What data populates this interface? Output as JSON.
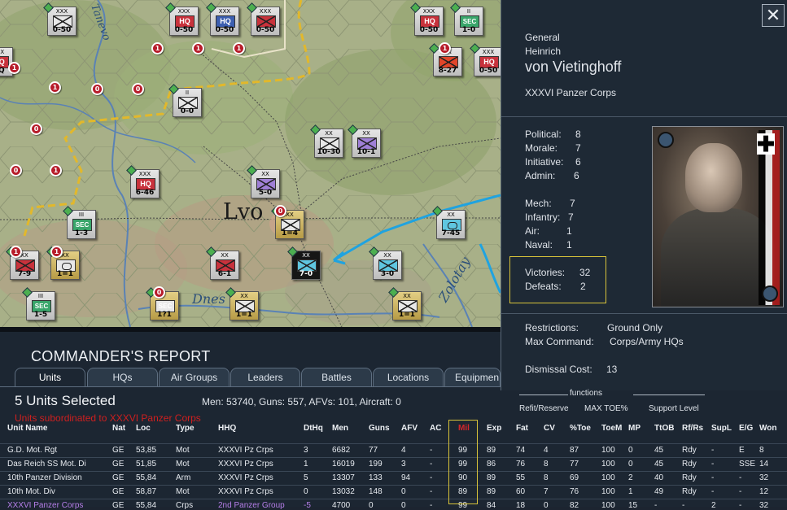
{
  "map": {
    "city": "Lvo",
    "river_labels": [
      "Dnes",
      "Zolotay",
      "Tanevo"
    ],
    "counters": [
      {
        "size": "XXX",
        "val": "0-50",
        "sym": "inf",
        "color": "#e8e8e8"
      },
      {
        "size": "XXX",
        "val": "0-50",
        "sym": "hq",
        "color": "#c8323c",
        "text": "HQ"
      },
      {
        "size": "XXX",
        "val": "0-50",
        "sym": "hq",
        "color": "#3d5fb0",
        "text": "HQ"
      },
      {
        "size": "XXX",
        "val": "0-50",
        "sym": "inf",
        "color": "#c8323c"
      },
      {
        "size": "XXX",
        "val": "0-50",
        "sym": "hq",
        "color": "#c8323c",
        "text": "HQ"
      },
      {
        "size": "II",
        "val": "1-0",
        "sym": "sec",
        "color": "#3aa66b",
        "text": "SEC"
      },
      {
        "size": "XX",
        "val": "8-27",
        "sym": "inf",
        "color": "#e0452a"
      },
      {
        "size": "XXX",
        "val": "0-50",
        "sym": "hq",
        "color": "#c8323c",
        "text": "HQ"
      },
      {
        "size": "XXX",
        "val": "HQ",
        "sym": "hq",
        "color": "#c8323c",
        "text": "HQ"
      },
      {
        "size": "II",
        "val": "0-0",
        "sym": "inf",
        "color": "#e8e8e8"
      },
      {
        "size": "XX",
        "val": "10-30",
        "sym": "inf",
        "color": "#e8e8e8"
      },
      {
        "size": "XX",
        "val": "10-1",
        "sym": "inf",
        "color": "#9f7fd6"
      },
      {
        "size": "XXX",
        "val": "6-46",
        "sym": "hq",
        "color": "#c8323c",
        "text": "HQ"
      },
      {
        "size": "XX",
        "val": "5-0",
        "sym": "inf",
        "color": "#9f7fd6"
      },
      {
        "size": "III",
        "val": "1-3",
        "sym": "sec",
        "color": "#3aa66b",
        "text": "SEC"
      },
      {
        "size": "XX",
        "val": "1=4",
        "sym": "inf",
        "color": "#e8e8e8"
      },
      {
        "size": "XX",
        "val": "7-45",
        "sym": "mot",
        "color": "#5fc6e0"
      },
      {
        "size": "XX",
        "val": "6-1",
        "sym": "inf",
        "color": "#c8323c"
      },
      {
        "size": "XX",
        "val": "7-0",
        "sym": "inf",
        "color": "#5fc6e0"
      },
      {
        "size": "XX",
        "val": "3-0",
        "sym": "inf",
        "color": "#5fc6e0"
      },
      {
        "size": "XX",
        "val": "7-9",
        "sym": "inf",
        "color": "#c8323c"
      },
      {
        "size": "XX",
        "val": "1=1",
        "sym": "mot",
        "color": "#e8e8e8"
      },
      {
        "size": "III",
        "val": "1-5",
        "sym": "sec",
        "color": "#3aa66b",
        "text": "SEC"
      },
      {
        "size": "",
        "val": "1?1",
        "sym": "sec",
        "color": "#e8e8e8",
        "text": "SEC"
      },
      {
        "size": "XX",
        "val": "1=1",
        "sym": "inf",
        "color": "#e8e8e8"
      },
      {
        "size": "XX",
        "val": "1=1",
        "sym": "inf",
        "color": "#e8e8e8"
      }
    ],
    "badges": [
      "1",
      "1",
      "1",
      "1",
      "0",
      "1",
      "0",
      "0",
      "1",
      "0",
      "1",
      "1",
      "1",
      "0",
      "0"
    ]
  },
  "commander": {
    "rank": "General",
    "first_name": "Heinrich",
    "last_name": "von Vietinghoff",
    "unit": "XXXVI Panzer Corps",
    "close_label": "✕",
    "ratings": [
      {
        "label": "Political:",
        "value": "8"
      },
      {
        "label": "Morale:",
        "value": "7"
      },
      {
        "label": "Initiative:",
        "value": "6"
      },
      {
        "label": "Admin:",
        "value": "6"
      },
      {
        "label": "Mech:",
        "value": "7"
      },
      {
        "label": "Infantry:",
        "value": "7"
      },
      {
        "label": "Air:",
        "value": "1"
      },
      {
        "label": "Naval:",
        "value": "1"
      }
    ],
    "victories_label": "Victories:",
    "victories": "32",
    "defeats_label": "Defeats:",
    "defeats": "2",
    "restrictions_label": "Restrictions:",
    "restrictions": "Ground Only",
    "max_command_label": "Max Command:",
    "max_command": "Corps/Army HQs",
    "dismissal_label": "Dismissal Cost:",
    "dismissal": "13"
  },
  "report": {
    "title": "COMMANDER'S REPORT",
    "tabs": [
      "Units",
      "HQs",
      "Air Groups",
      "Leaders",
      "Battles",
      "Locations",
      "Equipmen"
    ],
    "selected": "5 Units Selected",
    "summary": "Men: 53740, Guns: 557, AFVs: 101, Aircraft: 0",
    "warning": "Units subordinated to XXXVI Panzer Corps",
    "functions_label": "functions",
    "functions": [
      "Refit/Reserve",
      "MAX TOE%",
      "Support Level"
    ],
    "columns": [
      "Unit Name",
      "Nat",
      "Loc",
      "Type",
      "HHQ",
      "DtHq",
      "Men",
      "Guns",
      "AFV",
      "AC",
      "Mil",
      "Exp",
      "Fat",
      "CV",
      "%Toe",
      "ToeM",
      "MP",
      "TtOB",
      "Rf/Rs",
      "SupL",
      "E/G",
      "Won"
    ],
    "rows": [
      [
        "G.D. Mot. Rgt",
        "GE",
        "53,85",
        "Mot",
        "XXXVI Pz Crps",
        "3",
        "6682",
        "77",
        "4",
        "-",
        "99",
        "89",
        "74",
        "4",
        "87",
        "100",
        "0",
        "45",
        "Rdy",
        "-",
        "E",
        "8"
      ],
      [
        "Das Reich SS Mot. Di",
        "GE",
        "51,85",
        "Mot",
        "XXXVI Pz Crps",
        "1",
        "16019",
        "199",
        "3",
        "-",
        "99",
        "86",
        "76",
        "8",
        "77",
        "100",
        "0",
        "45",
        "Rdy",
        "-",
        "SSE",
        "14"
      ],
      [
        "10th Panzer Division",
        "GE",
        "55,84",
        "Arm",
        "XXXVI Pz Crps",
        "5",
        "13307",
        "133",
        "94",
        "-",
        "90",
        "89",
        "55",
        "8",
        "69",
        "100",
        "2",
        "40",
        "Rdy",
        "-",
        "-",
        "32"
      ],
      [
        "10th Mot. Div",
        "GE",
        "58,87",
        "Mot",
        "XXXVI Pz Crps",
        "0",
        "13032",
        "148",
        "0",
        "-",
        "89",
        "89",
        "60",
        "7",
        "76",
        "100",
        "1",
        "49",
        "Rdy",
        "-",
        "-",
        "12"
      ],
      [
        "XXXVI Panzer Corps",
        "GE",
        "55,84",
        "Crps",
        "2nd Panzer Group",
        "-5",
        "4700",
        "0",
        "0",
        "-",
        "99",
        "84",
        "18",
        "0",
        "82",
        "100",
        "15",
        "-",
        "-",
        "2",
        "-",
        "32"
      ]
    ]
  },
  "colors": {
    "highlight_box": "#d8c33a",
    "warning": "#d01f1f",
    "hq_link": "#b57ee8",
    "arrow": "#1fa3e0"
  }
}
